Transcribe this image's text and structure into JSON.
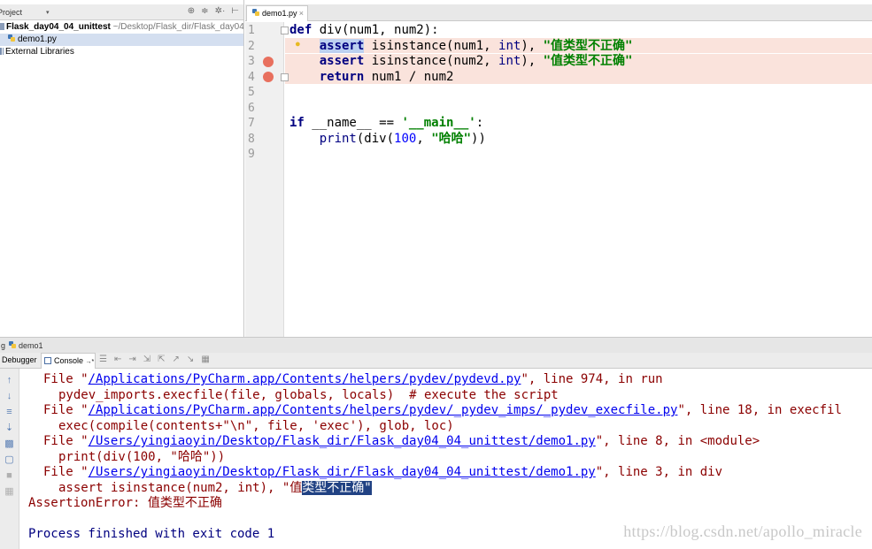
{
  "project": {
    "toolbar_label": "Project",
    "toolbar_icons": [
      "⊕",
      "≑",
      "✲·",
      "⊢"
    ],
    "root_name": "Flask_day04_04_unittest",
    "root_path": "~/Desktop/Flask_dir/Flask_day04",
    "file_name": "demo1.py",
    "external_libraries": "External Libraries"
  },
  "editor": {
    "tab_label": "demo1.py",
    "tab_close": "×",
    "line_numbers": [
      "1",
      "2",
      "3",
      "4",
      "5",
      "6",
      "7",
      "8",
      "9"
    ]
  },
  "code": {
    "l1_kw": "def",
    "l1_rest": " div(num1, num2):",
    "l2_kw": "assert",
    "l2_fn": " isinstance(num1, ",
    "l2_type": "int",
    "l2_sep": "), ",
    "l2_str": "\"值类型不正确\"",
    "l3_kw": "assert",
    "l3_fn": " isinstance(num2, ",
    "l3_type": "int",
    "l3_sep": "), ",
    "l3_str": "\"值类型不正确\"",
    "l4_kw": "return",
    "l4_rest": " num1 / num2",
    "l7_kw": "if",
    "l7_rest": " __name__ == ",
    "l7_str": "'__main__'",
    "l7_end": ":",
    "l8_fn": "print",
    "l8_a": "(div(",
    "l8_num": "100",
    "l8_b": ", ",
    "l8_str": "\"哈哈\"",
    "l8_c": "))"
  },
  "debug": {
    "window_title": "demo1",
    "window_prefix": "g",
    "tab_debugger": "Debugger",
    "tab_console": "Console",
    "tab_console_suffix": "→*",
    "toolbar_icons": [
      "☰",
      "⇤",
      "⇥",
      "⇲",
      "⇱",
      "↗",
      "↘",
      "▦"
    ]
  },
  "console": {
    "line1_pre": "File \"",
    "line1_link": "/Applications/PyCharm.app/Contents/helpers/pydev/pydevd.py",
    "line1_post": "\", line 974, in run",
    "line2": "pydev_imports.execfile(file, globals, locals)  # execute the script",
    "line3_pre": "File \"",
    "line3_link": "/Applications/PyCharm.app/Contents/helpers/pydev/_pydev_imps/_pydev_execfile.py",
    "line3_post": "\", line 18, in execfil",
    "line4": "exec(compile(contents+\"\\n\", file, 'exec'), glob, loc)",
    "line5_pre": "File \"",
    "line5_link": "/Users/yingiaoyin/Desktop/Flask_dir/Flask_day04_04_unittest/demo1.py",
    "line5_post": "\", line 8, in <module>",
    "line6": "print(div(100, \"哈哈\"))",
    "line7_pre": "File \"",
    "line7_link": "/Users/yingiaoyin/Desktop/Flask_dir/Flask_day04_04_unittest/demo1.py",
    "line7_post": "\", line 3, in div",
    "line8_pre": "assert isinstance(num2, int), \"值",
    "line8_sel": "类型不正确\"",
    "line9": "AssertionError: 值类型不正确",
    "line10": "Process finished with exit code 1"
  },
  "watermark": "https://blog.csdn.net/apollo_miracle"
}
